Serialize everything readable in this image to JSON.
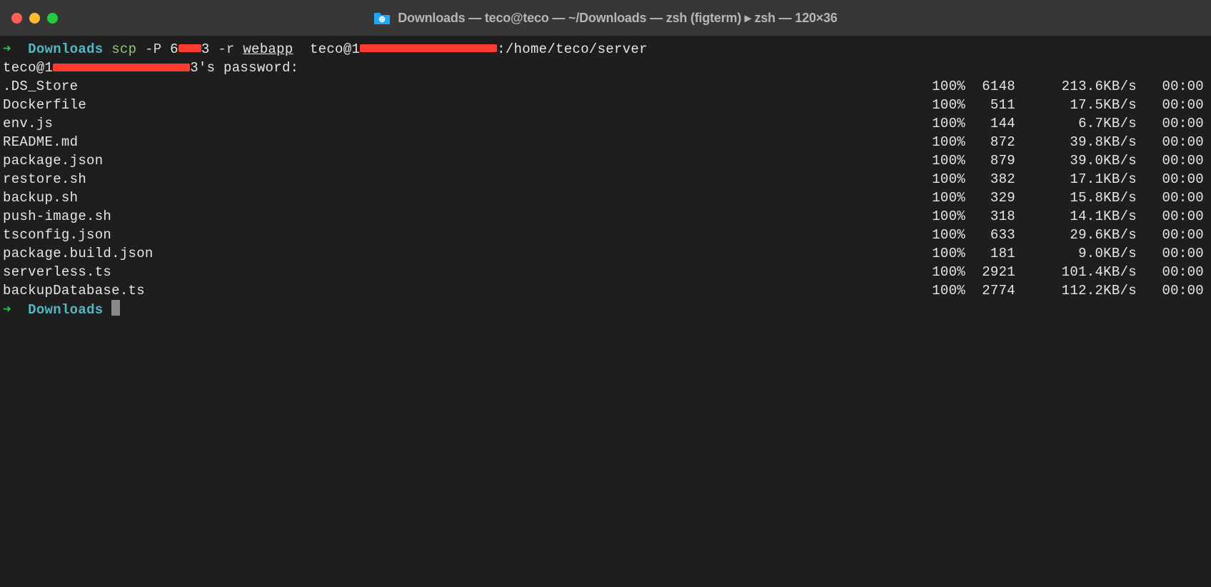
{
  "window": {
    "title": "Downloads — teco@teco — ~/Downloads — zsh (figterm) ▸ zsh — 120×36"
  },
  "prompt1": {
    "arrow": "➜",
    "cwd": "Downloads",
    "cmd": "scp",
    "flag_p": "-P",
    "port_prefix": "6",
    "port_suffix": "3",
    "flag_r": "-r",
    "src": "webapp",
    "user_host_prefix": "teco@1",
    "dest_path": ":/home/teco/server"
  },
  "password_line": {
    "prefix": "teco@1",
    "suffix": "3's password:"
  },
  "transfers": [
    {
      "name": ".DS_Store",
      "pct": "100%",
      "bytes": "6148",
      "speed": "213.6KB/s",
      "time": "00:00"
    },
    {
      "name": "Dockerfile",
      "pct": "100%",
      "bytes": "511",
      "speed": "17.5KB/s",
      "time": "00:00"
    },
    {
      "name": "env.js",
      "pct": "100%",
      "bytes": "144",
      "speed": "6.7KB/s",
      "time": "00:00"
    },
    {
      "name": "README.md",
      "pct": "100%",
      "bytes": "872",
      "speed": "39.8KB/s",
      "time": "00:00"
    },
    {
      "name": "package.json",
      "pct": "100%",
      "bytes": "879",
      "speed": "39.0KB/s",
      "time": "00:00"
    },
    {
      "name": "restore.sh",
      "pct": "100%",
      "bytes": "382",
      "speed": "17.1KB/s",
      "time": "00:00"
    },
    {
      "name": "backup.sh",
      "pct": "100%",
      "bytes": "329",
      "speed": "15.8KB/s",
      "time": "00:00"
    },
    {
      "name": "push-image.sh",
      "pct": "100%",
      "bytes": "318",
      "speed": "14.1KB/s",
      "time": "00:00"
    },
    {
      "name": "tsconfig.json",
      "pct": "100%",
      "bytes": "633",
      "speed": "29.6KB/s",
      "time": "00:00"
    },
    {
      "name": "package.build.json",
      "pct": "100%",
      "bytes": "181",
      "speed": "9.0KB/s",
      "time": "00:00"
    },
    {
      "name": "serverless.ts",
      "pct": "100%",
      "bytes": "2921",
      "speed": "101.4KB/s",
      "time": "00:00"
    },
    {
      "name": "backupDatabase.ts",
      "pct": "100%",
      "bytes": "2774",
      "speed": "112.2KB/s",
      "time": "00:00"
    }
  ],
  "prompt2": {
    "arrow": "➜",
    "cwd": "Downloads"
  }
}
